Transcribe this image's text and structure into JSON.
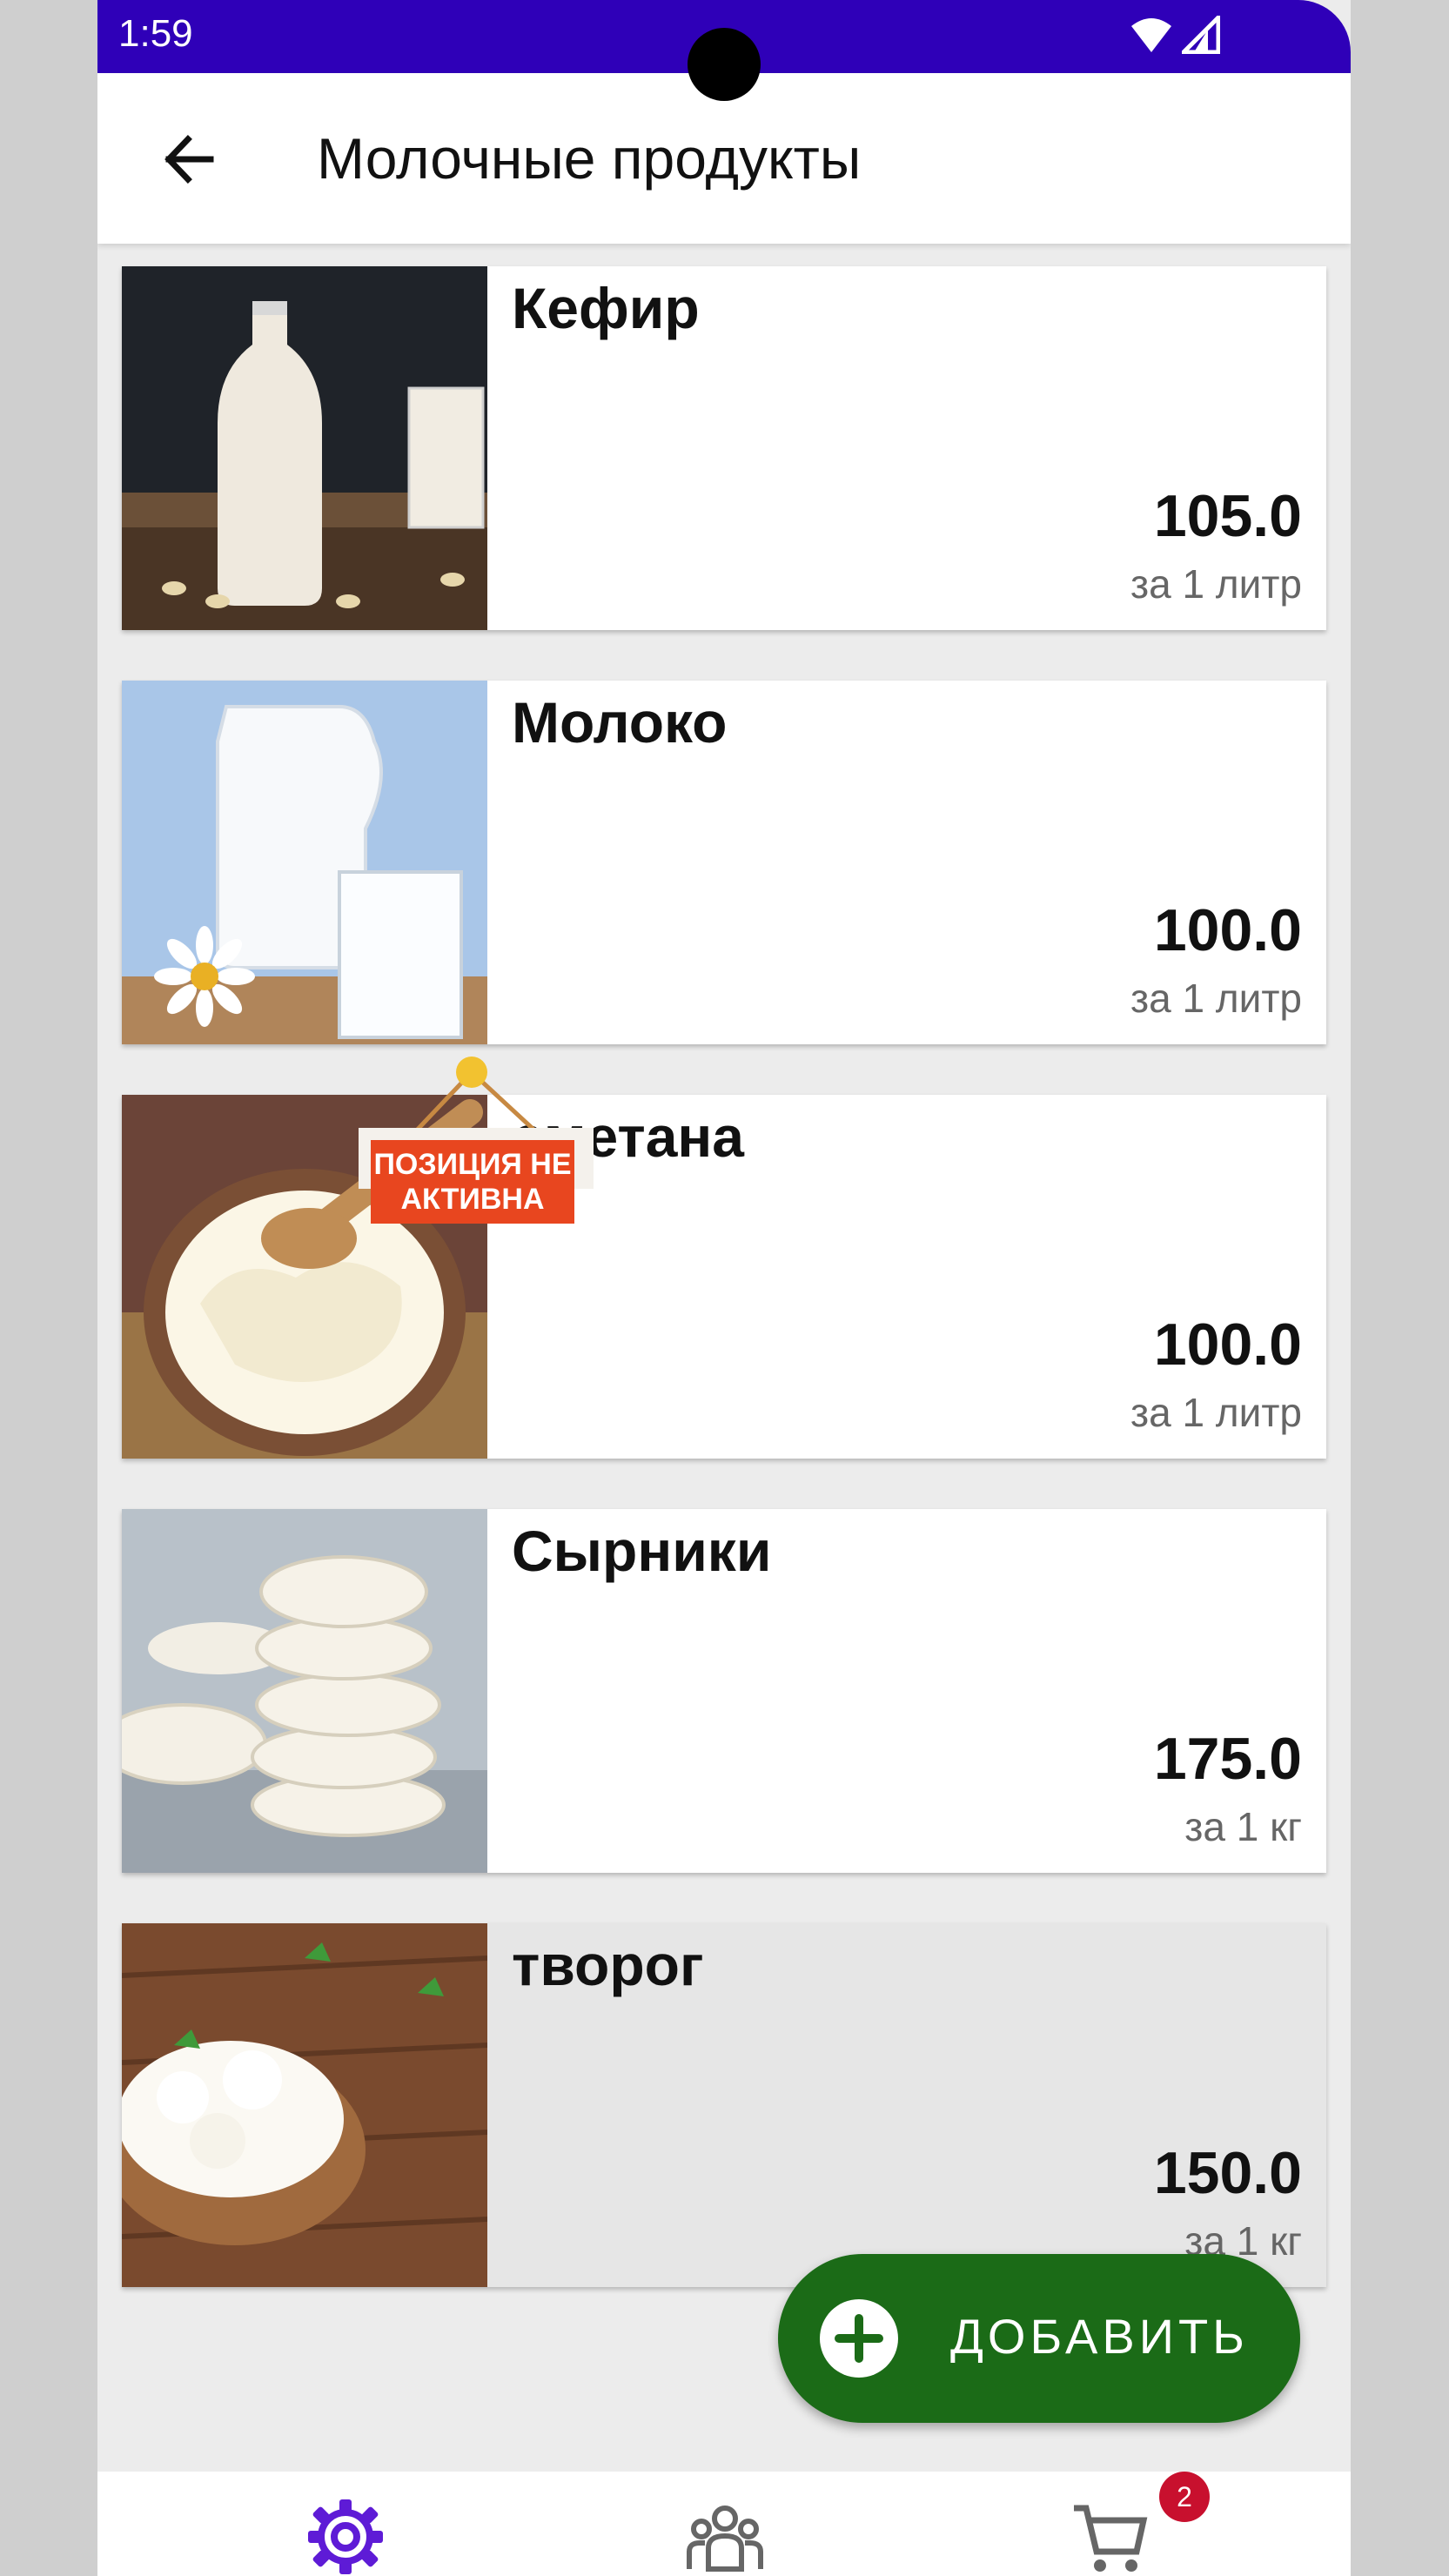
{
  "status_bar": {
    "time": "1:59"
  },
  "app_bar": {
    "title": "Молочные продукты"
  },
  "products": [
    {
      "name": "Кефир",
      "price": "105.0",
      "unit": "за 1 литр",
      "active": true
    },
    {
      "name": "Молоко",
      "price": "100.0",
      "unit": "за 1 литр",
      "active": true
    },
    {
      "name": "сметана",
      "price": "100.0",
      "unit": "за 1 литр",
      "active": true
    },
    {
      "name": "Сырники",
      "price": "175.0",
      "unit": "за 1 кг",
      "active": true
    },
    {
      "name": "творог",
      "price": "150.0",
      "unit": "за 1 кг",
      "active": false
    }
  ],
  "inactive_badge": {
    "line1": "ПОЗИЦИЯ НЕ",
    "line2": "АКТИВНА"
  },
  "fab": {
    "label": "ДОБАВИТЬ"
  },
  "bottom_nav": {
    "items": [
      {
        "icon": "gear-icon",
        "active": true
      },
      {
        "icon": "people-icon",
        "active": false
      },
      {
        "icon": "cart-icon",
        "active": false
      }
    ],
    "cart_badge": "2"
  },
  "colors": {
    "status_bar": "#2f00b8",
    "accent": "#5e1bd6",
    "fab": "#1b6b17",
    "badge": "#c8102e",
    "inactive_label": "#e8461f"
  }
}
